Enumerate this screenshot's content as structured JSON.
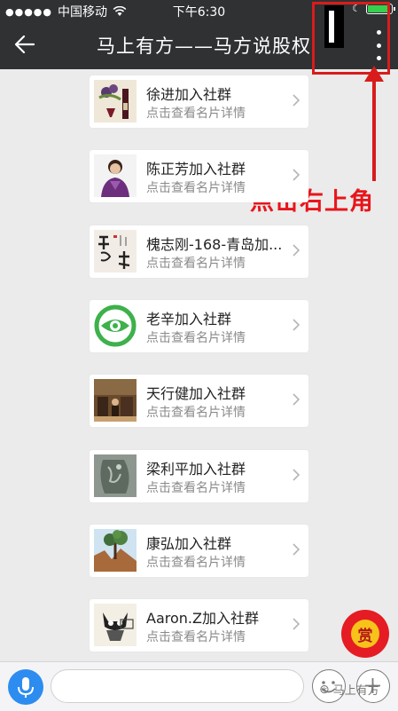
{
  "status_bar": {
    "carrier": "中国移动",
    "time": "下午6:30"
  },
  "nav": {
    "title": "马上有方——马方说股权"
  },
  "annotation": {
    "text": "点击右上角",
    "color": "#e8151b"
  },
  "cards": [
    {
      "name": "徐进加入社群",
      "subtitle": "点击查看名片详情",
      "avatar_icon": "wine-photo-avatar"
    },
    {
      "name": "陈正芳加入社群",
      "subtitle": "点击查看名片详情",
      "avatar_icon": "person-portrait-avatar"
    },
    {
      "name": "槐志刚-168-青岛加...",
      "subtitle": "点击查看名片详情",
      "avatar_icon": "calligraphy-avatar"
    },
    {
      "name": "老辛加入社群",
      "subtitle": "点击查看名片详情",
      "avatar_icon": "green-eye-logo-avatar"
    },
    {
      "name": "天行健加入社群",
      "subtitle": "点击查看名片详情",
      "avatar_icon": "room-photo-avatar"
    },
    {
      "name": "梁利平加入社群",
      "subtitle": "点击查看名片详情",
      "avatar_icon": "stone-art-avatar"
    },
    {
      "name": "康弘加入社群",
      "subtitle": "点击查看名片详情",
      "avatar_icon": "tree-landscape-avatar"
    },
    {
      "name": "Aaron.Z加入社群",
      "subtitle": "点击查看名片详情",
      "avatar_icon": "cartoon-cat-avatar"
    }
  ],
  "reward_badge": {
    "label": "赏"
  },
  "watermark": {
    "text": "马上有方"
  }
}
